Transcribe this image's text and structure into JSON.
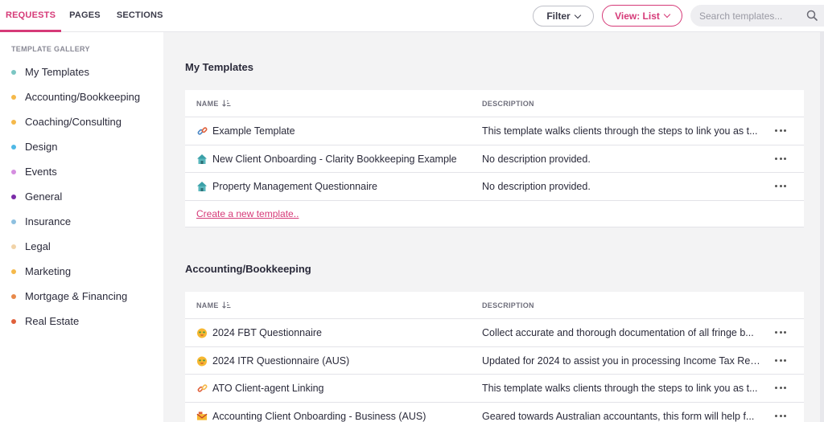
{
  "tabs": [
    {
      "label": "REQUESTS",
      "active": true
    },
    {
      "label": "PAGES",
      "active": false
    },
    {
      "label": "SECTIONS",
      "active": false
    }
  ],
  "toolbar": {
    "filter_label": "Filter",
    "view_label": "View: List",
    "search_placeholder": "Search templates..."
  },
  "sidebar": {
    "heading": "TEMPLATE GALLERY",
    "items": [
      {
        "label": "My Templates",
        "color": "#7bc6c3"
      },
      {
        "label": "Accounting/Bookkeeping",
        "color": "#f5b94a"
      },
      {
        "label": "Coaching/Consulting",
        "color": "#f5b94a"
      },
      {
        "label": "Design",
        "color": "#4fb8e6"
      },
      {
        "label": "Events",
        "color": "#d58ee0"
      },
      {
        "label": "General",
        "color": "#7b2ca8"
      },
      {
        "label": "Insurance",
        "color": "#8ec0e0"
      },
      {
        "label": "Legal",
        "color": "#f1d3a8"
      },
      {
        "label": "Marketing",
        "color": "#f5b94a"
      },
      {
        "label": "Mortgage & Financing",
        "color": "#e8894a"
      },
      {
        "label": "Real Estate",
        "color": "#e0603a"
      }
    ]
  },
  "sections": [
    {
      "title": "My Templates",
      "col_name": "NAME",
      "col_desc": "DESCRIPTION",
      "rows": [
        {
          "icon": "link-icon",
          "name": "Example Template",
          "description": "This template walks clients through the steps to link you as t..."
        },
        {
          "icon": "house-icon",
          "name": "New Client Onboarding - Clarity Bookkeeping Example",
          "description": "No description provided."
        },
        {
          "icon": "house-icon",
          "name": "Property Management Questionnaire",
          "description": "No description provided."
        }
      ],
      "create_link": "Create a new template.."
    },
    {
      "title": "Accounting/Bookkeeping",
      "col_name": "NAME",
      "col_desc": "DESCRIPTION",
      "rows": [
        {
          "icon": "money-face-icon",
          "name": "2024 FBT Questionnaire",
          "description": "Collect accurate and thorough documentation of all fringe b..."
        },
        {
          "icon": "money-face-icon",
          "name": "2024 ITR Questionnaire (AUS)",
          "description": "Updated for 2024 to assist you in processing Income Tax Ret..."
        },
        {
          "icon": "link-icon",
          "name": "ATO Client-agent Linking",
          "description": "This template walks clients through the steps to link you as t..."
        },
        {
          "icon": "envelope-icon",
          "name": "Accounting Client Onboarding - Business (AUS)",
          "description": "Geared towards Australian accountants, this form will help f..."
        }
      ]
    }
  ]
}
